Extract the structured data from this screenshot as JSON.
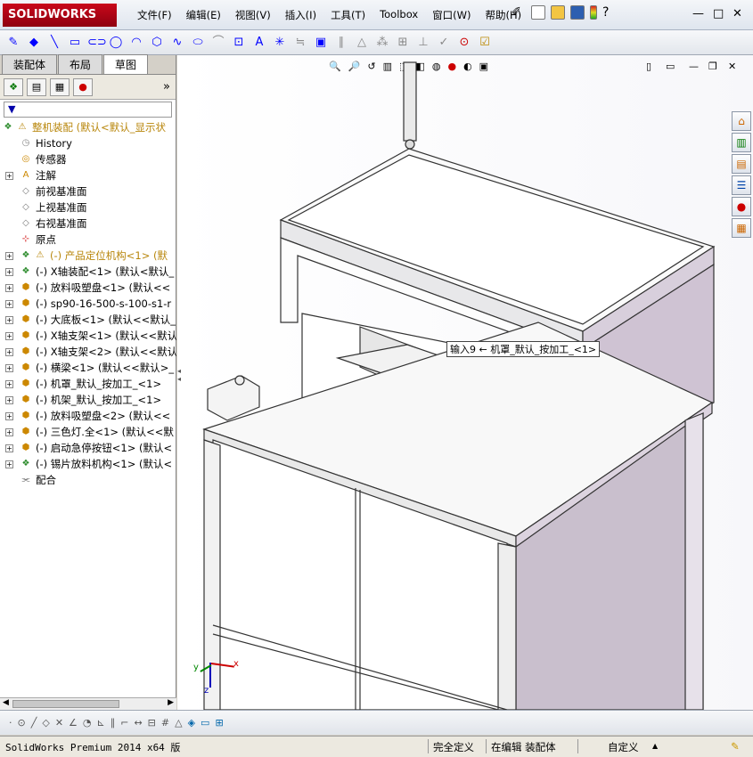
{
  "app": {
    "logo": "SOLIDWORKS"
  },
  "menu": [
    "文件(F)",
    "编辑(E)",
    "视图(V)",
    "插入(I)",
    "工具(T)",
    "Toolbox",
    "窗口(W)",
    "帮助(H)"
  ],
  "tabs": [
    "装配体",
    "布局",
    "草图"
  ],
  "filter": "▼",
  "tree": [
    {
      "label": "整机装配 (默认<默认_显示状",
      "color": "#b8860b",
      "icon": "asm",
      "indent": 0
    },
    {
      "label": "History",
      "color": "#000",
      "icon": "hist",
      "indent": 1
    },
    {
      "label": "传感器",
      "color": "#000",
      "icon": "sens",
      "indent": 1
    },
    {
      "label": "注解",
      "color": "#000",
      "icon": "anno",
      "indent": 1,
      "exp": "+"
    },
    {
      "label": "前视基准面",
      "color": "#000",
      "icon": "plane",
      "indent": 1
    },
    {
      "label": "上视基准面",
      "color": "#000",
      "icon": "plane",
      "indent": 1
    },
    {
      "label": "右视基准面",
      "color": "#000",
      "icon": "plane",
      "indent": 1
    },
    {
      "label": "原点",
      "color": "#000",
      "icon": "origin",
      "indent": 1
    },
    {
      "label": "(-) 产品定位机构<1> (默",
      "color": "#b8860b",
      "icon": "subasm",
      "indent": 1,
      "exp": "+"
    },
    {
      "label": "(-) X轴装配<1> (默认<默认_",
      "color": "#000",
      "icon": "subasm",
      "indent": 1,
      "exp": "+"
    },
    {
      "label": "(-) 放料吸塑盘<1> (默认<<",
      "color": "#000",
      "icon": "part",
      "indent": 1,
      "exp": "+"
    },
    {
      "label": "(-) sp90-16-500-s-100-s1-r",
      "color": "#000",
      "icon": "part",
      "indent": 1,
      "exp": "+"
    },
    {
      "label": "(-) 大底板<1> (默认<<默认_",
      "color": "#000",
      "icon": "part",
      "indent": 1,
      "exp": "+"
    },
    {
      "label": "(-) X轴支架<1> (默认<<默认",
      "color": "#000",
      "icon": "part",
      "indent": 1,
      "exp": "+"
    },
    {
      "label": "(-) X轴支架<2> (默认<<默认",
      "color": "#000",
      "icon": "part",
      "indent": 1,
      "exp": "+"
    },
    {
      "label": "(-) 横梁<1> (默认<<默认>_",
      "color": "#000",
      "icon": "part",
      "indent": 1,
      "exp": "+"
    },
    {
      "label": "(-) 机罩_默认_按加工_<1>",
      "color": "#000",
      "icon": "part",
      "indent": 1,
      "exp": "+"
    },
    {
      "label": "(-) 机架_默认_按加工_<1>",
      "color": "#000",
      "icon": "part",
      "indent": 1,
      "exp": "+"
    },
    {
      "label": "(-) 放料吸塑盘<2> (默认<<",
      "color": "#000",
      "icon": "part",
      "indent": 1,
      "exp": "+"
    },
    {
      "label": "(-) 三色灯.全<1> (默认<<默",
      "color": "#000",
      "icon": "part",
      "indent": 1,
      "exp": "+"
    },
    {
      "label": "(-) 启动急停按钮<1> (默认<",
      "color": "#000",
      "icon": "part",
      "indent": 1,
      "exp": "+"
    },
    {
      "label": "(-) 锡片放料机构<1> (默认<",
      "color": "#000",
      "icon": "subasm",
      "indent": 1,
      "exp": "+"
    },
    {
      "label": "配合",
      "color": "#000",
      "icon": "mate",
      "indent": 1
    }
  ],
  "callout": "输入9 ← 机罩_默认_按加工_<1>",
  "triad": {
    "x": "x",
    "y": "y",
    "z": "z"
  },
  "status": {
    "product": "SolidWorks Premium 2014 x64 版",
    "defined": "完全定义",
    "editing": "在编辑 装配体",
    "units": "自定义",
    "arrow": "▲"
  }
}
